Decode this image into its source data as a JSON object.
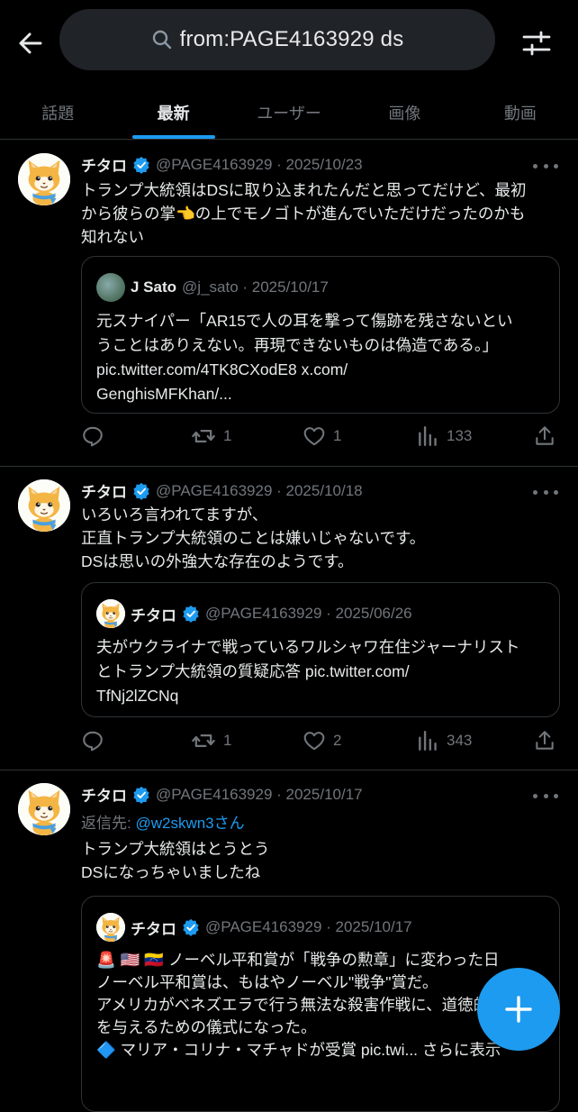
{
  "search": {
    "query": "from:PAGE4163929 ds"
  },
  "tabs": [
    {
      "label": "話題",
      "active": false
    },
    {
      "label": "最新",
      "active": true
    },
    {
      "label": "ユーザー",
      "active": false
    },
    {
      "label": "画像",
      "active": false
    },
    {
      "label": "動画",
      "active": false
    }
  ],
  "tweets": [
    {
      "name": "チタロ",
      "meta": "@PAGE4163929 · 2025/10/23",
      "body_lines": [
        "トランプ大統領はDSに取り込まれたんだと思ってだけど、最初",
        "から彼らの掌👈の上でモノゴトが進んでいただけだったのかも",
        "知れない"
      ],
      "quote": {
        "name": "J Sato",
        "meta": "@j_sato · 2025/10/17",
        "body_lines": [
          "元スナイパー「AR15で人の耳を撃って傷跡を残さないとい",
          "うことはありえない。再現できないものは偽造である。」",
          "pic.twitter.com/4TK8CXodE8 x.com/",
          "GenghisMFKhan/..."
        ]
      },
      "stats": {
        "replies": "",
        "retweets": "1",
        "likes": "1",
        "views": "133"
      }
    },
    {
      "name": "チタロ",
      "meta": "@PAGE4163929 · 2025/10/18",
      "body_lines": [
        "いろいろ言われてますが、",
        "正直トランプ大統領のことは嫌いじゃないです。",
        "DSは思いの外強大な存在のようです。"
      ],
      "quote": {
        "name": "チタロ",
        "meta": "@PAGE4163929 · 2025/06/26",
        "body_lines": [
          "夫がウクライナで戦っているワルシャワ在住ジャーナリスト",
          "とトランプ大統領の質疑応答 pic.twitter.com/",
          "TfNj2lZCNq"
        ]
      },
      "stats": {
        "replies": "",
        "retweets": "1",
        "likes": "2",
        "views": "343"
      }
    },
    {
      "name": "チタロ",
      "meta": "@PAGE4163929 · 2025/10/17",
      "reply_label": "返信先: ",
      "reply_handle": "@w2skwn3さん",
      "body_lines": [
        "トランプ大統領はとうとう",
        "DSになっちゃいましたね"
      ],
      "quote": {
        "name": "チタロ",
        "meta": "@PAGE4163929 · 2025/10/17",
        "body_lines": [
          "🚨 🇺🇸 🇻🇪 ノーベル平和賞が「戦争の勲章」に変わった日",
          "ノーベル平和賞は、もはやノーベル\"戦争\"賞だ。",
          "アメリカがベネズエラで行う無法な殺害作戦に、道徳的な体裁",
          "を与えるための儀式になった。",
          "🔷 マリア・コリナ・マチャドが受賞 pic.twi... さらに表示"
        ]
      }
    }
  ],
  "colors": {
    "accent": "#1d9bf0",
    "muted": "#71767b",
    "text": "#e7e9ea",
    "background": "#000000"
  }
}
